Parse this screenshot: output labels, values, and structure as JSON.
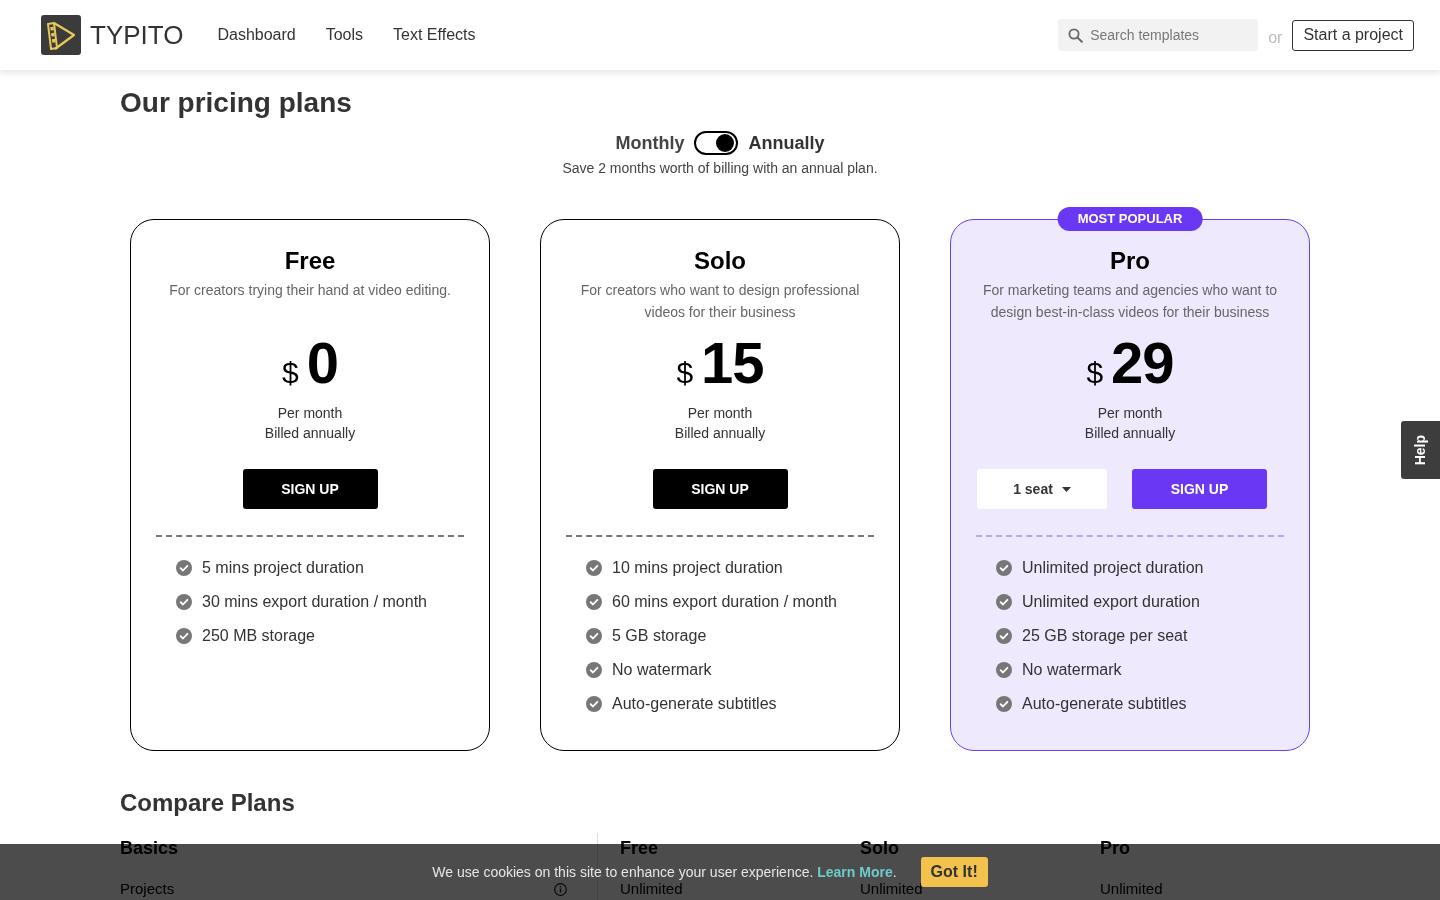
{
  "header": {
    "logo_text": "TYPITO",
    "nav": [
      "Dashboard",
      "Tools",
      "Text Effects"
    ],
    "search": {
      "placeholder": "Search templates"
    },
    "separator": "or",
    "cta": "Start a project"
  },
  "pricing": {
    "title": "Our pricing plans",
    "billing": {
      "monthly_label": "Monthly",
      "annually_label": "Annually",
      "annual": true,
      "note": "Save 2 months worth of billing with an annual plan."
    },
    "plans": [
      {
        "name": "Free",
        "description": "For creators trying their hand at video editing.",
        "currency": "$",
        "price": "0",
        "period": "Per month",
        "billing": "Billed annually",
        "button": "SIGN UP",
        "highlighted": false,
        "features": [
          "5 mins project duration",
          "30 mins export duration / month",
          "250 MB storage"
        ]
      },
      {
        "name": "Solo",
        "description": "For creators who want to design professional videos for their business",
        "currency": "$",
        "price": "15",
        "period": "Per month",
        "billing": "Billed annually",
        "button": "SIGN UP",
        "highlighted": false,
        "features": [
          "10 mins project duration",
          "60 mins export duration / month",
          "5 GB storage",
          "No watermark",
          "Auto-generate subtitles"
        ]
      },
      {
        "name": "Pro",
        "badge": "MOST POPULAR",
        "description": "For marketing teams and agencies who want to design best-in-class videos for their business",
        "currency": "$",
        "price": "29",
        "period": "Per month",
        "billing": "Billed annually",
        "seats": "1 seat",
        "button": "SIGN UP",
        "highlighted": true,
        "features": [
          "Unlimited project duration",
          "Unlimited export duration",
          "25 GB storage per seat",
          "No watermark",
          "Auto-generate subtitles"
        ]
      }
    ]
  },
  "compare": {
    "title": "Compare Plans",
    "columns": [
      "Basics",
      "Free",
      "Solo",
      "Pro"
    ],
    "rows": [
      {
        "label": "Projects",
        "values": [
          "Unlimited",
          "Unlimited",
          "Unlimited"
        ]
      }
    ]
  },
  "help_tab": {
    "label": "Help"
  },
  "cookie_banner": {
    "message": "We use cookies on this site to enhance your user experience.",
    "link": "Learn More",
    "suffix": ".",
    "button": "Got It!"
  }
}
